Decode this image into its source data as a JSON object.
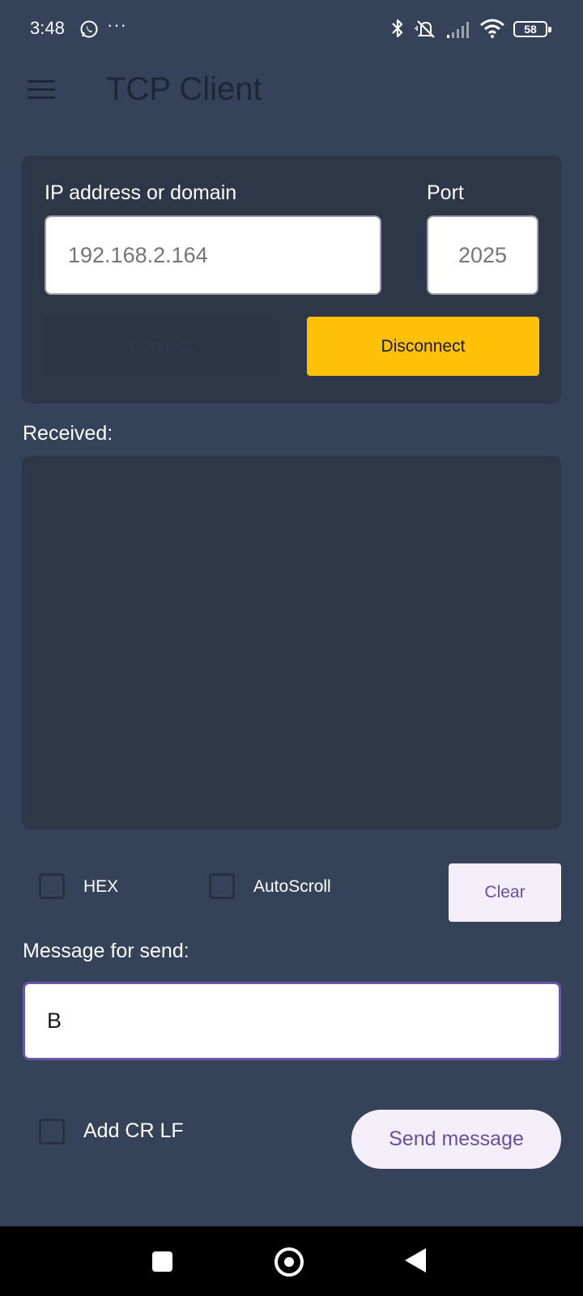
{
  "status_bar": {
    "time": "3:48",
    "more_indicator": "···",
    "battery_level": "58",
    "icons": [
      "whatsapp-icon",
      "bluetooth-icon",
      "mute-icon",
      "signal-icon",
      "wifi-icon",
      "battery-icon"
    ]
  },
  "app_bar": {
    "title": "TCP Client",
    "menu_icon": "hamburger-menu-icon"
  },
  "connection": {
    "ip_label": "IP address or domain",
    "ip_placeholder": "192.168.2.164",
    "port_label": "Port",
    "port_placeholder": "2025",
    "connect_label": "Connect",
    "disconnect_label": "Disconnect"
  },
  "received": {
    "label": "Received:",
    "content": ""
  },
  "options": {
    "hex_label": "HEX",
    "autoscroll_label": "AutoScroll",
    "clear_label": "Clear"
  },
  "message": {
    "label": "Message for send:",
    "value": "B",
    "crlf_label": "Add CR LF",
    "send_label": "Send message"
  },
  "colors": {
    "background": "#344359",
    "card": "#2d3748",
    "accent": "#ffc107",
    "primary": "#6750a4"
  }
}
